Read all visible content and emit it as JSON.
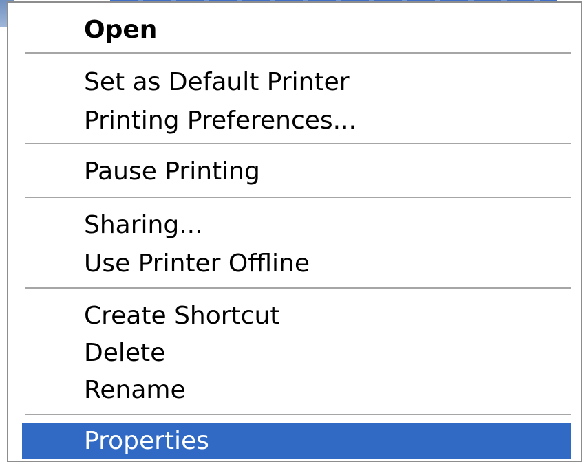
{
  "context_menu": {
    "items": [
      {
        "label": "Open",
        "default": true
      },
      {
        "label": "Set as Default Printer"
      },
      {
        "label": "Printing Preferences..."
      },
      {
        "label": "Pause Printing"
      },
      {
        "label": "Sharing..."
      },
      {
        "label": "Use Printer Offline"
      },
      {
        "label": "Create Shortcut"
      },
      {
        "label": "Delete"
      },
      {
        "label": "Rename"
      },
      {
        "label": "Properties",
        "selected": true
      }
    ]
  },
  "colors": {
    "highlight": "#316ac5",
    "separator": "#a6a6a6",
    "border": "#8d8d8d"
  }
}
